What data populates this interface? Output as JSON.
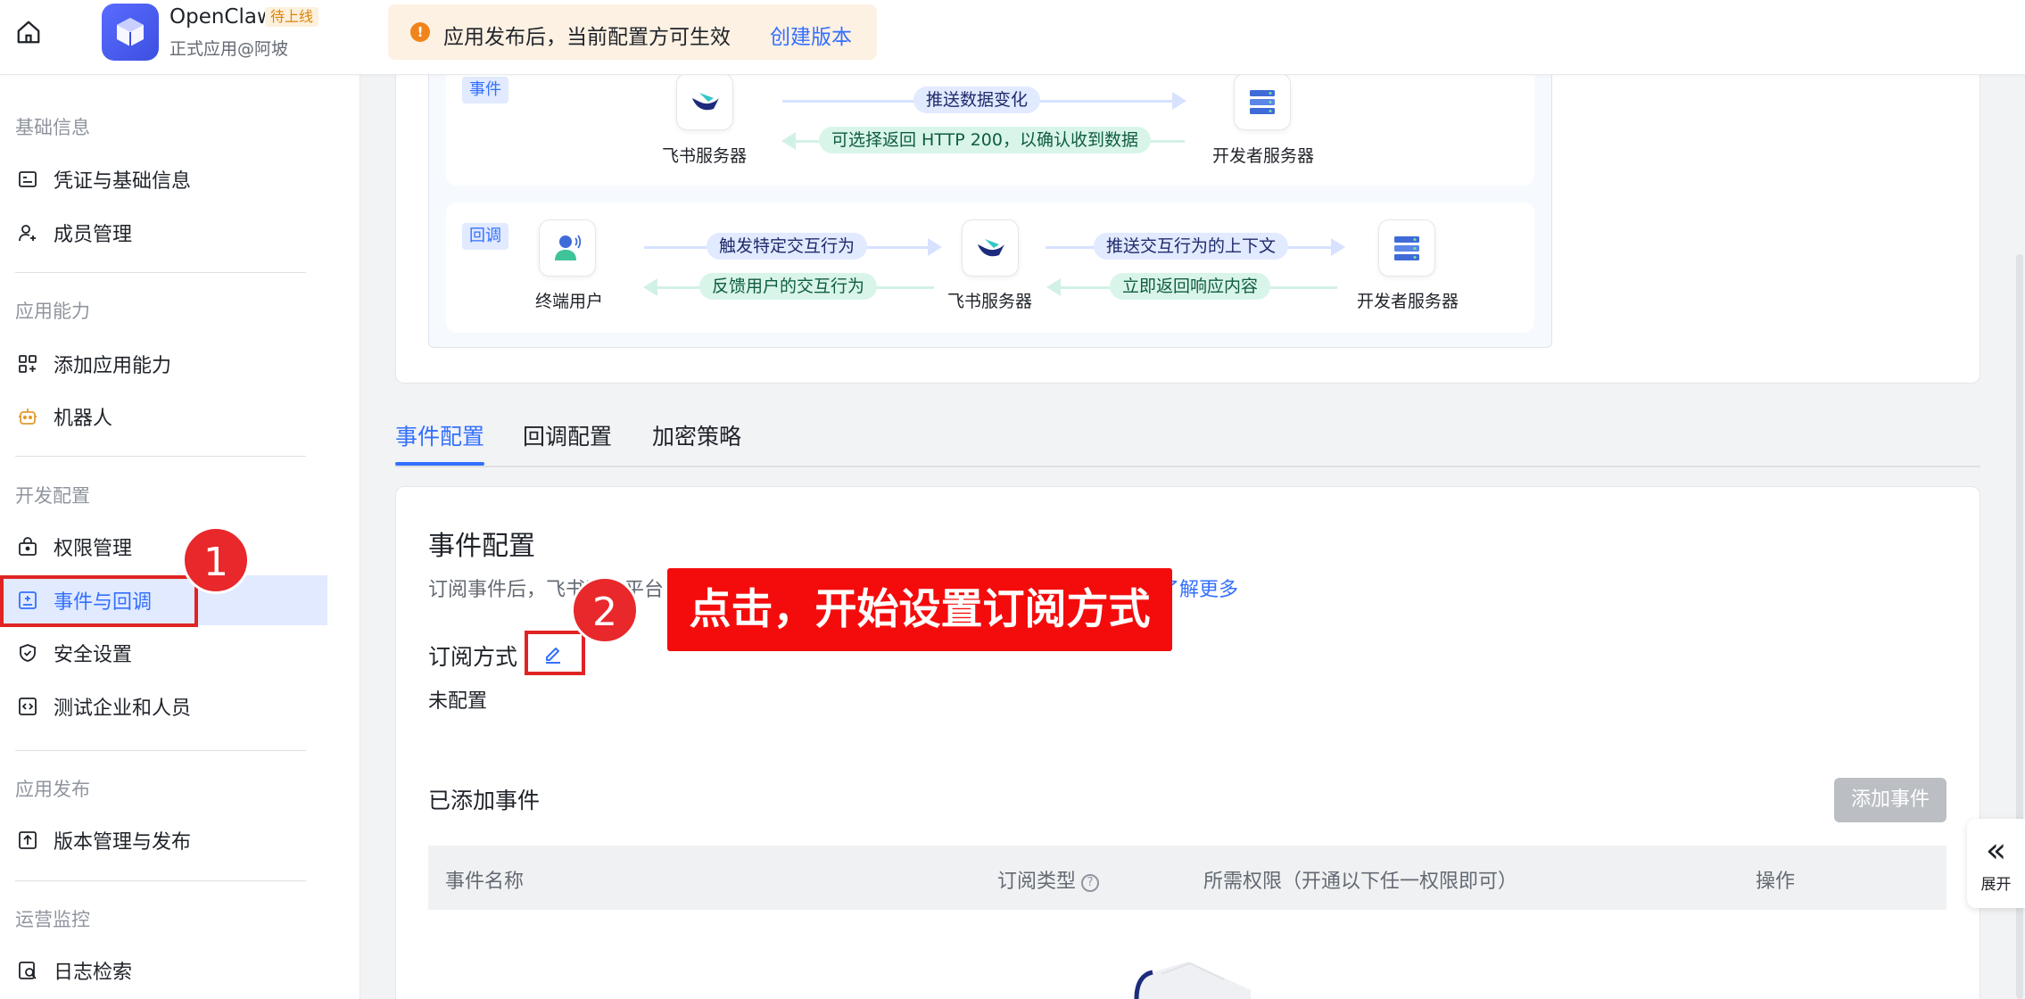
{
  "header": {
    "app_name": "OpenClaw",
    "app_badge": "待上线",
    "app_sub": "正式应用@阿坡",
    "notice_text": "应用发布后，当前配置方可生效",
    "notice_link": "创建版本",
    "notice_icon": "!"
  },
  "sidebar": {
    "groups": [
      {
        "label": "基础信息"
      },
      {
        "label": "应用能力"
      },
      {
        "label": "开发配置"
      },
      {
        "label": "应用发布"
      },
      {
        "label": "运营监控"
      }
    ],
    "items": [
      {
        "label": "凭证与基础信息",
        "icon": "id-card-icon"
      },
      {
        "label": "成员管理",
        "icon": "user-add-icon"
      },
      {
        "label": "添加应用能力",
        "icon": "grid-add-icon"
      },
      {
        "label": "机器人",
        "icon": "robot-icon"
      },
      {
        "label": "权限管理",
        "icon": "lock-icon"
      },
      {
        "label": "事件与回调",
        "icon": "event-icon",
        "active": true
      },
      {
        "label": "安全设置",
        "icon": "shield-icon"
      },
      {
        "label": "测试企业和人员",
        "icon": "code-icon"
      },
      {
        "label": "版本管理与发布",
        "icon": "upload-icon"
      },
      {
        "label": "日志检索",
        "icon": "log-search-icon"
      }
    ]
  },
  "diagram": {
    "event_tag": "事件",
    "event_push": "推送数据变化",
    "event_return": "可选择返回 HTTP 200，以确认收到数据",
    "feishu_server": "飞书服务器",
    "dev_server": "开发者服务器",
    "callback_tag": "回调",
    "end_user": "终端用户",
    "cb_trigger": "触发特定交互行为",
    "cb_feedback": "反馈用户的交互行为",
    "cb_push_context": "推送交互行为的上下文",
    "cb_return": "立即返回响应内容"
  },
  "tabs": [
    {
      "label": "事件配置",
      "active": true
    },
    {
      "label": "回调配置"
    },
    {
      "label": "加密策略"
    }
  ],
  "event_config": {
    "title": "事件配置",
    "desc": "订阅事件后，飞书开放平台",
    "learn_more": "了解更多",
    "subscription_label": "订阅方式",
    "subscription_status": "未配置",
    "added_title": "已添加事件",
    "add_button": "添加事件",
    "table_headers": {
      "name": "事件名称",
      "type": "订阅类型",
      "permission": "所需权限（开通以下任一权限即可）",
      "action": "操作"
    },
    "help_glyph": "?"
  },
  "expand_panel": {
    "chevron": "«",
    "label": "展开"
  },
  "annotations": {
    "step1": "1",
    "step2": "2",
    "callout": "点击，开始设置订阅方式"
  },
  "colors": {
    "accent": "#3370ff",
    "annotation_red": "#e8282b",
    "warning": "#f0841b"
  }
}
